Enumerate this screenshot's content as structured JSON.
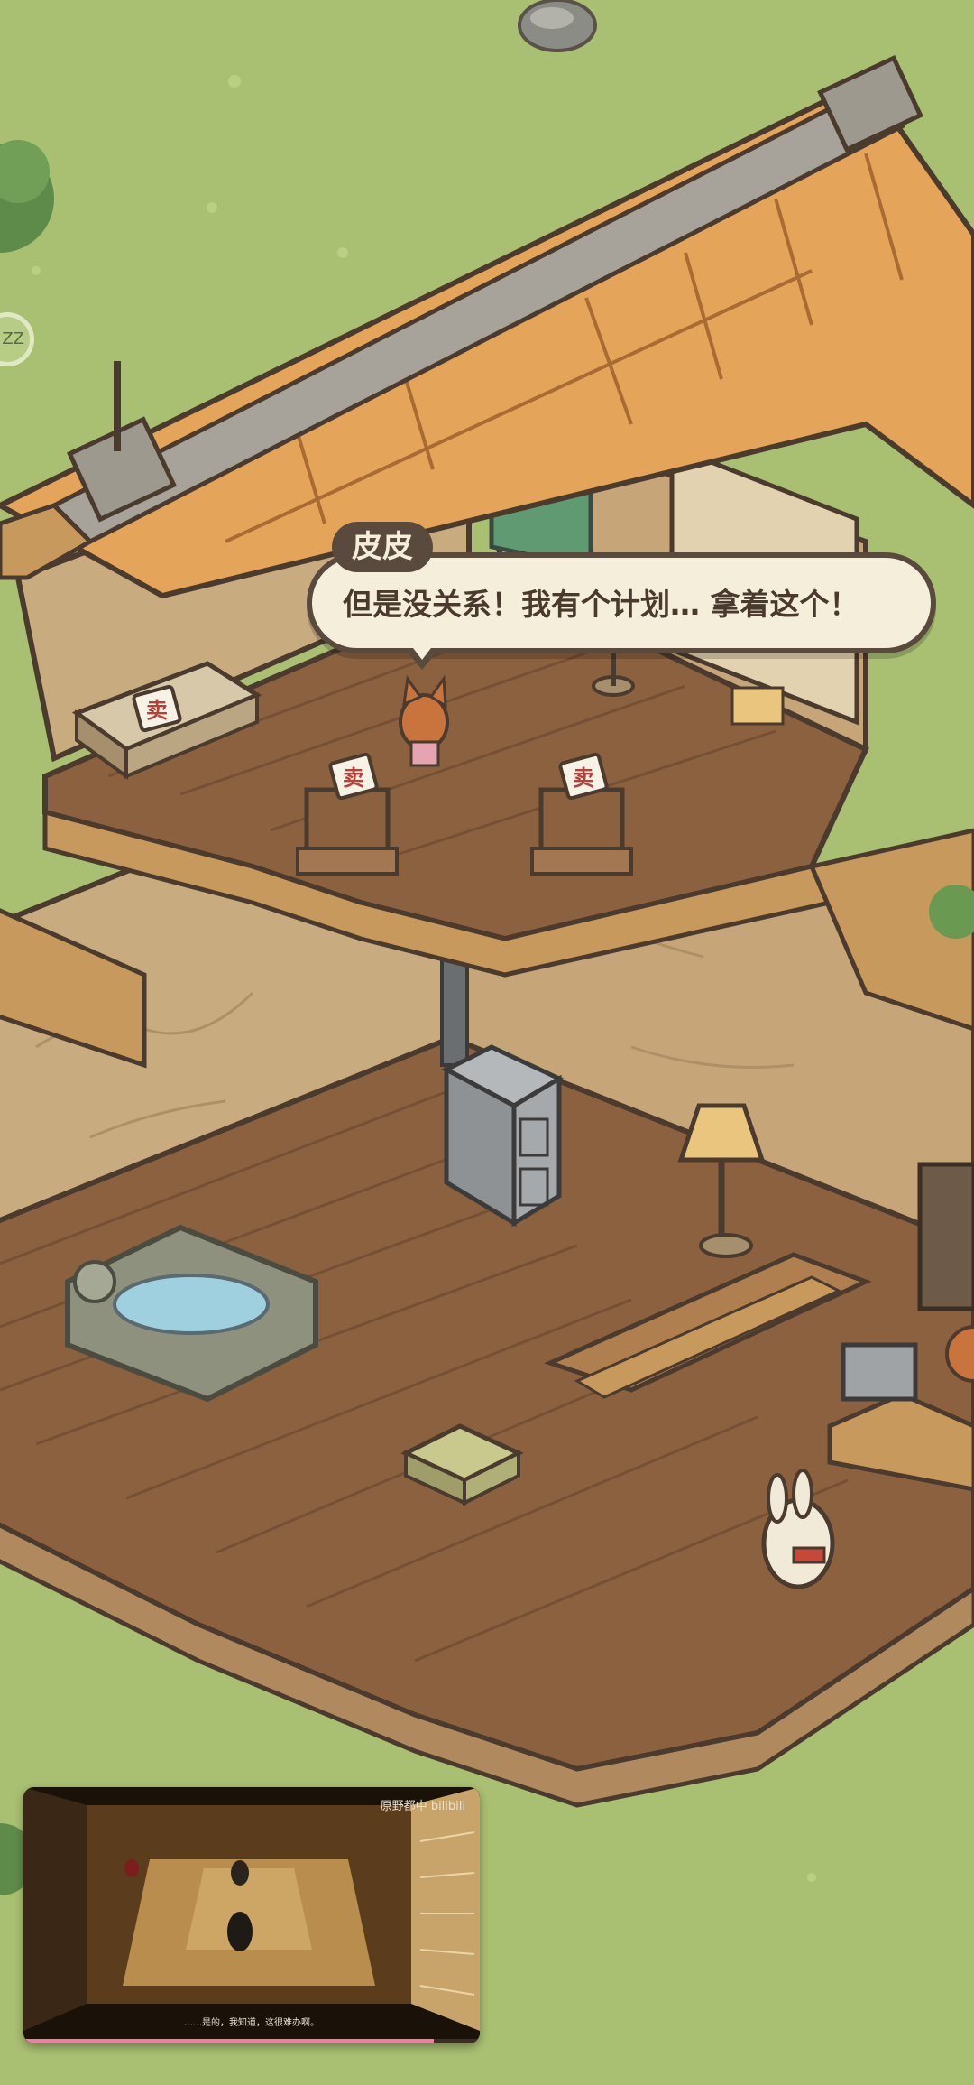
{
  "dialog": {
    "speaker": "皮皮",
    "text": "但是没关系！我有个计划… 拿着这个！"
  },
  "shop": {
    "sign_label": "卖"
  },
  "side_button": {
    "label": "ZZ"
  },
  "pip_video": {
    "channel": "原野都中",
    "platform": "bilibili",
    "subtitle": "……是的，我知道，这很难办啊。",
    "progress": 0.9
  },
  "colors": {
    "grass": "#a9bf72",
    "wood_floor": "#8a5e3c",
    "wall": "#c9ab80",
    "roof": "#e4a55a",
    "dialog_bg": "#f4eedb",
    "dialog_border": "#5a4a3d",
    "progress": "#f07ea3"
  }
}
